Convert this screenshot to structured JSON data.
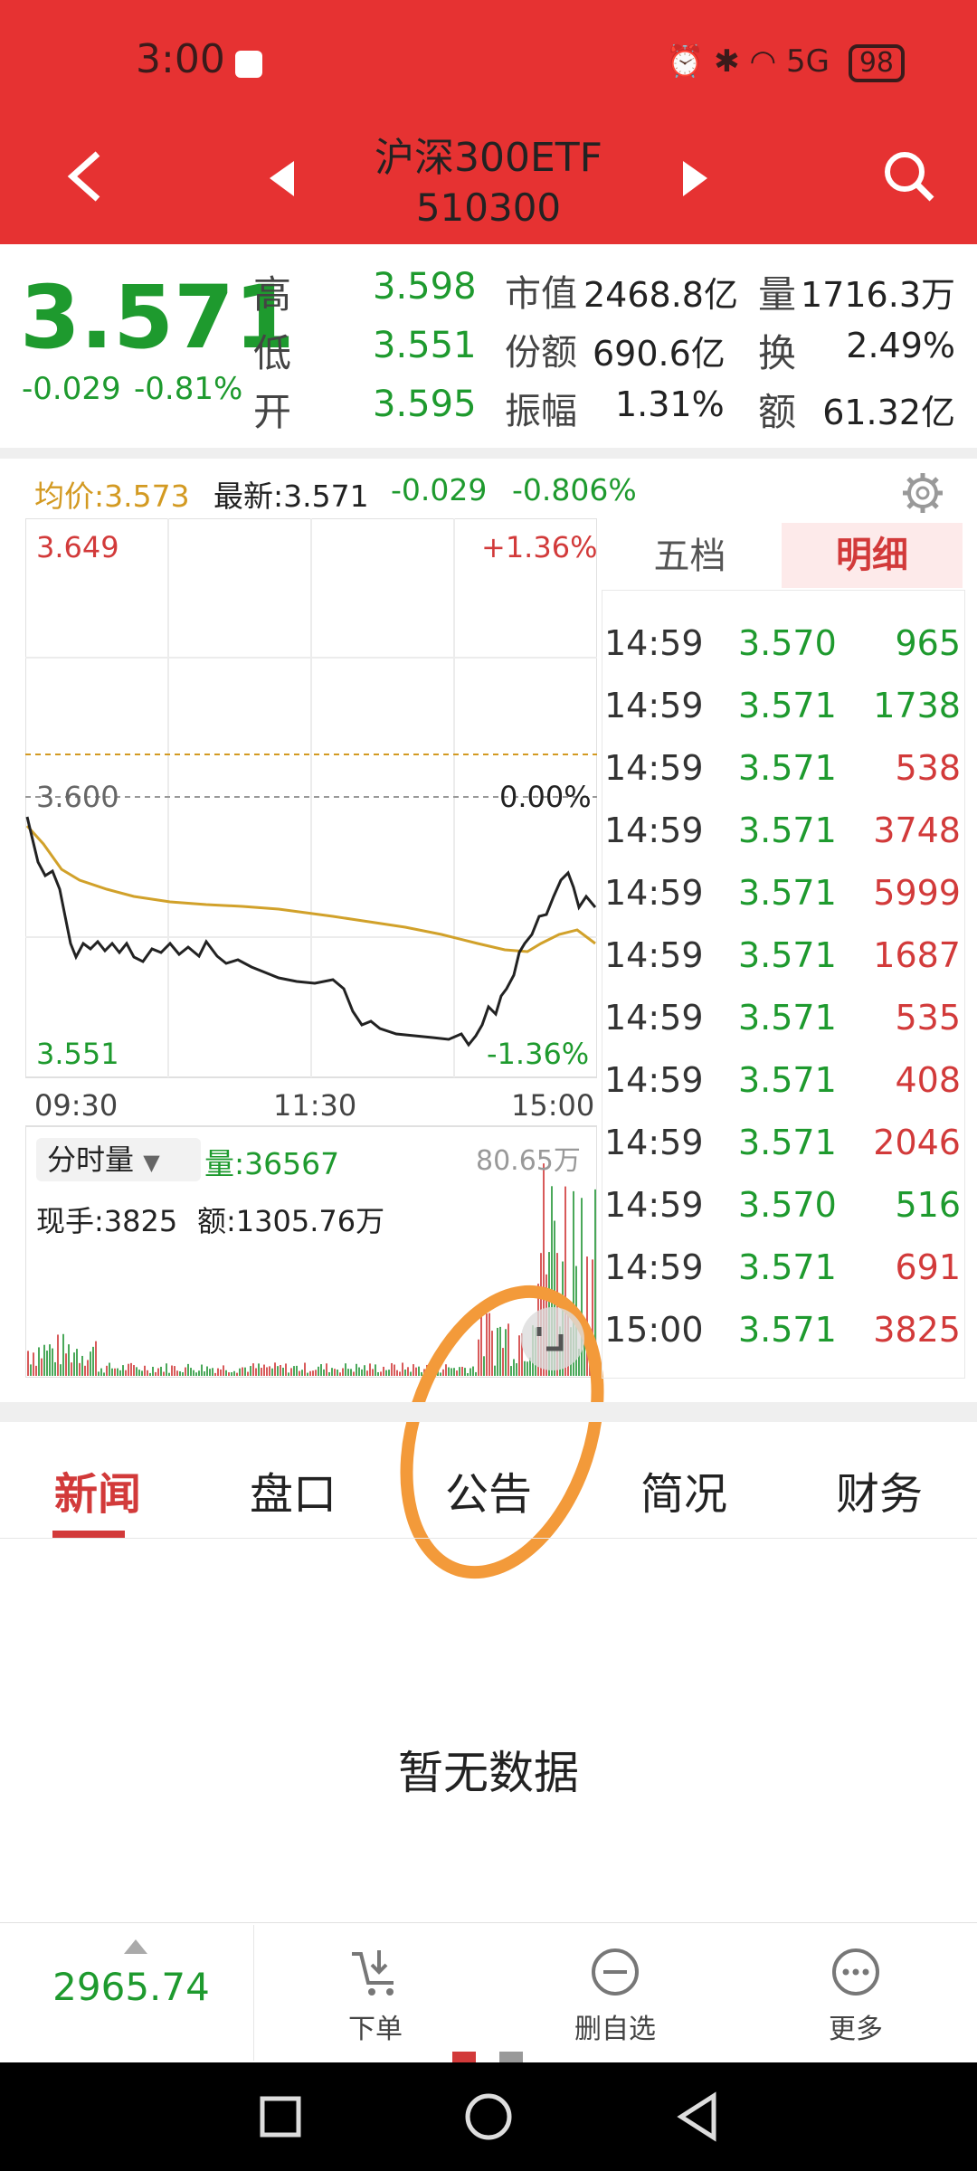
{
  "status": {
    "time": "3:00",
    "signal": "5G",
    "battery": "98"
  },
  "header": {
    "name": "沪深300ETF",
    "code": "510300"
  },
  "quote": {
    "price": "3.571",
    "change": "-0.029",
    "change_pct": "-0.81%",
    "labels": {
      "high": "高",
      "low": "低",
      "open": "开",
      "market_cap": "市值",
      "shares": "份额",
      "amplitude": "振幅",
      "volume": "量",
      "turnover": "换",
      "amount": "额"
    },
    "high": "3.598",
    "low": "3.551",
    "open": "3.595",
    "market_cap": "2468.8亿",
    "shares": "690.6亿",
    "amplitude": "1.31%",
    "volume": "1716.3万",
    "turnover": "2.49%",
    "amount": "61.32亿"
  },
  "summary": {
    "avg_price": "均价:3.573",
    "latest": "最新:3.571",
    "change": "-0.029",
    "change_pct": "-0.806%"
  },
  "tabs": {
    "five_levels": "五档",
    "details": "明细"
  },
  "chart": {
    "y_top": "3.649",
    "y_mid": "3.600",
    "y_bottom": "3.551",
    "pct_top": "+1.36%",
    "pct_mid": "0.00%",
    "pct_bottom": "-1.36%",
    "x_labels": [
      "09:30",
      "11:30",
      "15:00"
    ]
  },
  "volume_panel": {
    "selector": "分时量",
    "volume": "量:36567",
    "max": "80.65万",
    "current_hand": "现手:3825",
    "amount": "额:1305.76万"
  },
  "details": [
    {
      "time": "14:59",
      "price": "3.570",
      "volume": "965",
      "color": "#1e9a2e"
    },
    {
      "time": "14:59",
      "price": "3.571",
      "volume": "1738",
      "color": "#1e9a2e"
    },
    {
      "time": "14:59",
      "price": "3.571",
      "volume": "538",
      "color": "#d23a3a"
    },
    {
      "time": "14:59",
      "price": "3.571",
      "volume": "3748",
      "color": "#d23a3a"
    },
    {
      "time": "14:59",
      "price": "3.571",
      "volume": "5999",
      "color": "#d23a3a"
    },
    {
      "time": "14:59",
      "price": "3.571",
      "volume": "1687",
      "color": "#d23a3a"
    },
    {
      "time": "14:59",
      "price": "3.571",
      "volume": "535",
      "color": "#d23a3a"
    },
    {
      "time": "14:59",
      "price": "3.571",
      "volume": "408",
      "color": "#d23a3a"
    },
    {
      "time": "14:59",
      "price": "3.571",
      "volume": "2046",
      "color": "#d23a3a"
    },
    {
      "time": "14:59",
      "price": "3.570",
      "volume": "516",
      "color": "#1e9a2e"
    },
    {
      "time": "14:59",
      "price": "3.571",
      "volume": "691",
      "color": "#d23a3a"
    },
    {
      "time": "15:00",
      "price": "3.571",
      "volume": "3825",
      "color": "#d23a3a"
    }
  ],
  "news_tabs": [
    "新闻",
    "盘口",
    "公告",
    "简况",
    "财务"
  ],
  "empty": "暂无数据",
  "bottom": {
    "index_value": "2965.74",
    "order": "下单",
    "remove_watch": "删自选",
    "more": "更多"
  }
}
